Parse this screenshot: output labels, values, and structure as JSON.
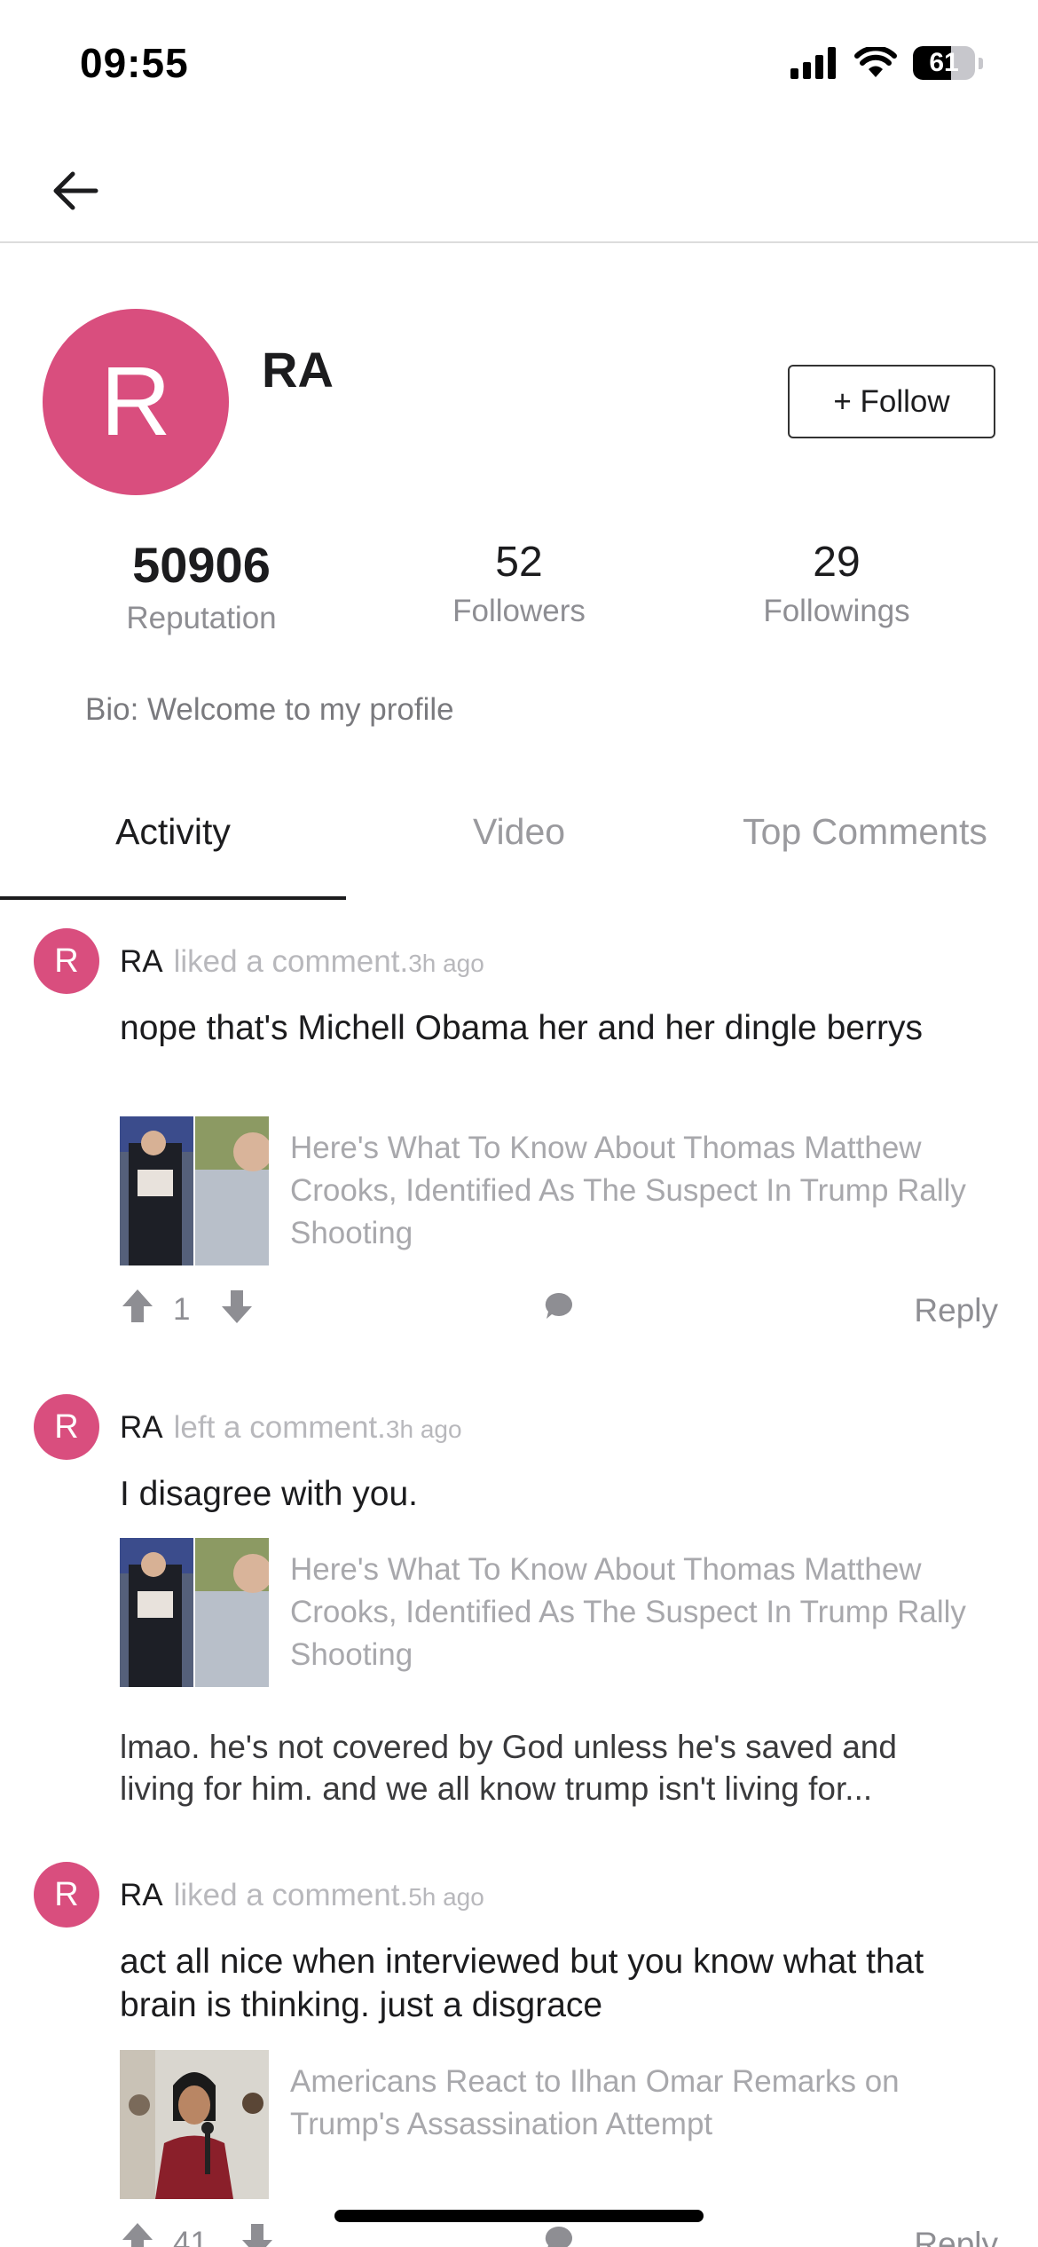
{
  "status_bar": {
    "time": "09:55",
    "battery": "61",
    "battery_level": 0.61
  },
  "profile": {
    "initial": "R",
    "name": "RA",
    "follow_label": "+ Follow",
    "stats": {
      "reputation": {
        "value": "50906",
        "label": "Reputation"
      },
      "followers": {
        "value": "52",
        "label": "Followers"
      },
      "followings": {
        "value": "29",
        "label": "Followings"
      }
    },
    "bio": "Bio: Welcome to my profile"
  },
  "tabs": [
    {
      "label": "Activity",
      "active": true
    },
    {
      "label": "Video",
      "active": false
    },
    {
      "label": "Top Comments",
      "active": false
    }
  ],
  "feed": [
    {
      "initial": "R",
      "user": "RA",
      "action": "liked a comment.",
      "time": "3h ago",
      "comment": "nope that's Michell Obama her and her dingle berrys",
      "article_title": "Here's What To Know About Thomas Matthew Crooks, Identified As The Suspect In Trump Rally Shooting",
      "votes": "1",
      "reply_label": "Reply"
    },
    {
      "initial": "R",
      "user": "RA",
      "action": "left a comment.",
      "time": "3h ago",
      "comment": "I disagree with you.",
      "article_title": "Here's What To Know About Thomas Matthew Crooks, Identified As The Suspect In Trump Rally Shooting",
      "reply_excerpt": "lmao. he's not covered by God unless he's saved and living for him. and we all know trump isn't living for..."
    },
    {
      "initial": "R",
      "user": "RA",
      "action": "liked a comment.",
      "time": "5h ago",
      "comment": "act all nice when interviewed but you know what that brain is thinking. just a disgrace",
      "article_title": "Americans React to Ilhan Omar Remarks on Trump's Assassination Attempt",
      "votes": "41",
      "reply_label": "Reply"
    }
  ],
  "colors": {
    "avatar": "#d94e7e",
    "muted": "#8e8e93",
    "text": "#1c1c1e"
  },
  "icons": [
    "back-arrow-icon",
    "signal-icon",
    "wifi-icon",
    "battery-icon",
    "thumbs-up-icon",
    "thumbs-down-icon",
    "comment-bubble-icon"
  ]
}
